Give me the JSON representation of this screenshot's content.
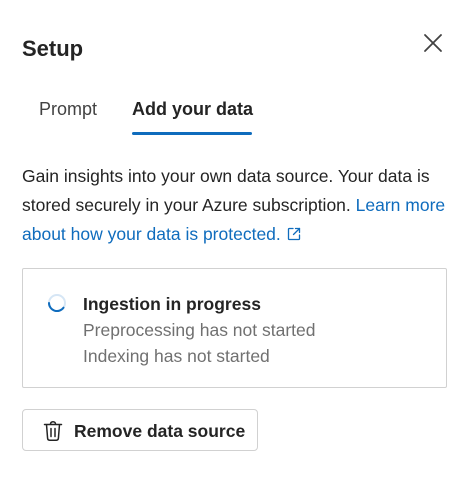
{
  "dialog": {
    "title": "Setup",
    "close_icon": "close-icon"
  },
  "tabs": [
    {
      "label": "Prompt",
      "selected": false
    },
    {
      "label": "Add your data",
      "selected": true
    }
  ],
  "description": {
    "text": "Gain insights into your own data source. Your data is stored securely in your Azure subscription.",
    "link_text": "Learn more about how your data is protected.",
    "link_icon": "external-link-icon"
  },
  "status": {
    "icon": "spinner-icon",
    "title": "Ingestion in progress",
    "lines": [
      "Preprocessing has not started",
      "Indexing has not started"
    ]
  },
  "remove_button": {
    "icon": "trash-icon",
    "label": "Remove data source"
  },
  "colors": {
    "accent": "#0f6cbd",
    "text": "#242424",
    "secondary_text": "#707070",
    "border": "#d1d1d1"
  }
}
